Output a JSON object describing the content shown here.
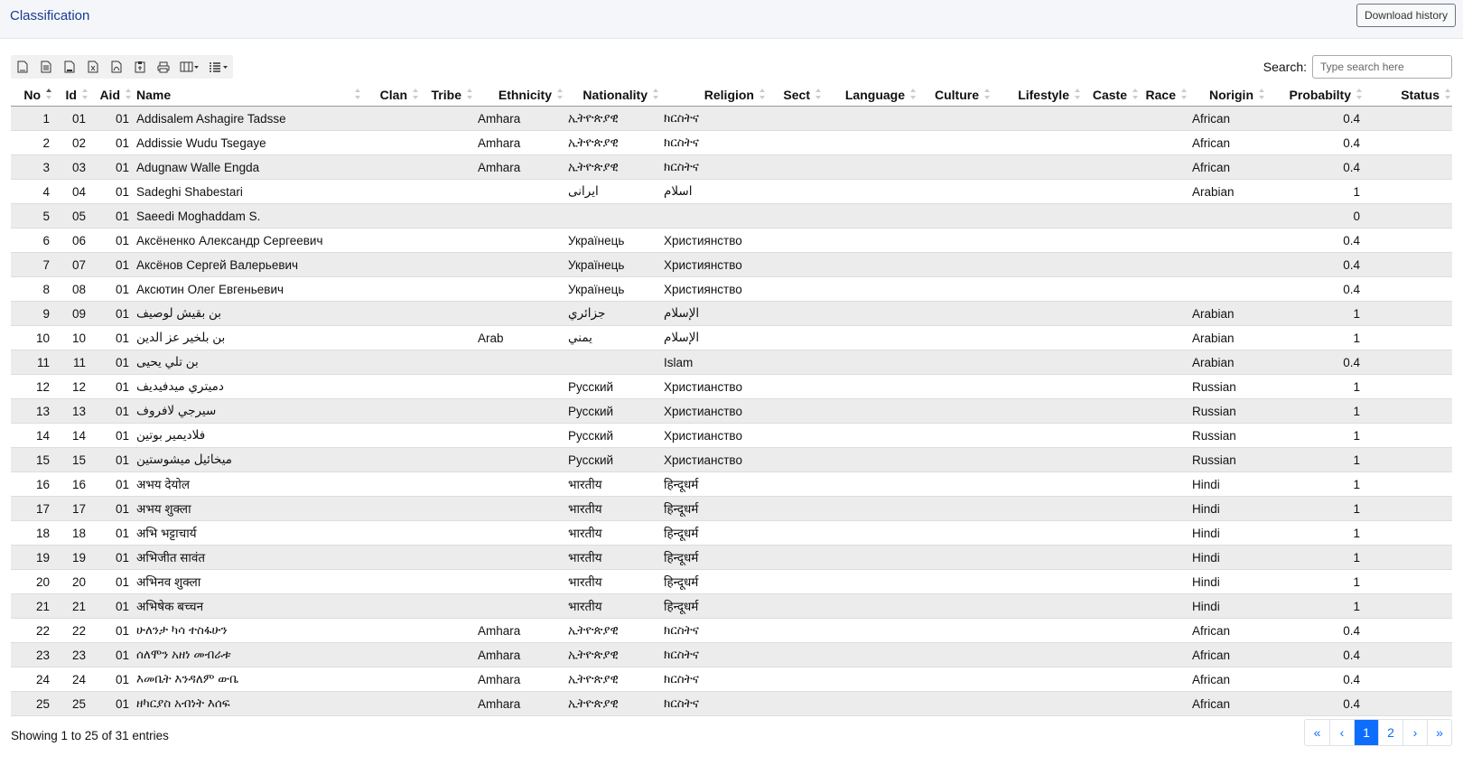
{
  "header": {
    "title": "Classification",
    "download_label": "Download history"
  },
  "toolbar": {
    "buttons": [
      "csv-export-icon",
      "copy-icon",
      "pdf-export-icon",
      "excel-export-icon",
      "file-export-icon",
      "clipboard-icon",
      "print-icon",
      "column-visibility-icon",
      "page-length-icon"
    ]
  },
  "search": {
    "label": "Search:",
    "placeholder": "Type search here"
  },
  "table": {
    "columns": [
      "No",
      "Id",
      "Aid",
      "Name",
      "Clan",
      "Tribe",
      "Ethnicity",
      "Nationality",
      "Religion",
      "Sect",
      "Language",
      "Culture",
      "Lifestyle",
      "Caste",
      "Race",
      "Norigin",
      "Probabilty",
      "Status"
    ],
    "rows": [
      [
        "1",
        "01",
        "01",
        "Addisalem Ashagire Tadsse",
        "",
        "",
        "Amhara",
        "ኢትዮጵያዊ",
        "ክርስትና",
        "",
        "",
        "",
        "",
        "",
        "",
        "African",
        "0.4",
        ""
      ],
      [
        "2",
        "02",
        "01",
        "Addissie Wudu Tsegaye",
        "",
        "",
        "Amhara",
        "ኢትዮጵያዊ",
        "ክርስትና",
        "",
        "",
        "",
        "",
        "",
        "",
        "African",
        "0.4",
        ""
      ],
      [
        "3",
        "03",
        "01",
        "Adugnaw Walle Engda",
        "",
        "",
        "Amhara",
        "ኢትዮጵያዊ",
        "ክርስትና",
        "",
        "",
        "",
        "",
        "",
        "",
        "African",
        "0.4",
        ""
      ],
      [
        "4",
        "04",
        "01",
        "Sadeghi Shabestari",
        "",
        "",
        "",
        "ایرانی",
        "اسلام",
        "",
        "",
        "",
        "",
        "",
        "",
        "Arabian",
        "1",
        ""
      ],
      [
        "5",
        "05",
        "01",
        "Saeedi Moghaddam S.",
        "",
        "",
        "",
        "",
        "",
        "",
        "",
        "",
        "",
        "",
        "",
        "",
        "0",
        ""
      ],
      [
        "6",
        "06",
        "01",
        "Аксёненко Александр Сергеевич",
        "",
        "",
        "",
        "Українець",
        "Християнство",
        "",
        "",
        "",
        "",
        "",
        "",
        "",
        "0.4",
        ""
      ],
      [
        "7",
        "07",
        "01",
        "Аксёнов Сергей Валерьевич",
        "",
        "",
        "",
        "Українець",
        "Християнство",
        "",
        "",
        "",
        "",
        "",
        "",
        "",
        "0.4",
        ""
      ],
      [
        "8",
        "08",
        "01",
        "Аксютин Олег Евгеньевич",
        "",
        "",
        "",
        "Українець",
        "Християнство",
        "",
        "",
        "",
        "",
        "",
        "",
        "",
        "0.4",
        ""
      ],
      [
        "9",
        "09",
        "01",
        "بن بقيش لوصيف",
        "",
        "",
        "",
        "جزائري",
        "الإسلام",
        "",
        "",
        "",
        "",
        "",
        "",
        "Arabian",
        "1",
        ""
      ],
      [
        "10",
        "10",
        "01",
        "بن بلخير عز الدين",
        "",
        "",
        "Arab",
        "يمني",
        "الإسلام",
        "",
        "",
        "",
        "",
        "",
        "",
        "Arabian",
        "1",
        ""
      ],
      [
        "11",
        "11",
        "01",
        "بن تلي يحيى",
        "",
        "",
        "",
        "",
        "Islam",
        "",
        "",
        "",
        "",
        "",
        "",
        "Arabian",
        "0.4",
        ""
      ],
      [
        "12",
        "12",
        "01",
        "دميتري ميدفيديف",
        "",
        "",
        "",
        "Русский",
        "Христианство",
        "",
        "",
        "",
        "",
        "",
        "",
        "Russian",
        "1",
        ""
      ],
      [
        "13",
        "13",
        "01",
        "سيرجي لافروف",
        "",
        "",
        "",
        "Русский",
        "Христианство",
        "",
        "",
        "",
        "",
        "",
        "",
        "Russian",
        "1",
        ""
      ],
      [
        "14",
        "14",
        "01",
        "فلاديمير بوتين",
        "",
        "",
        "",
        "Русский",
        "Христианство",
        "",
        "",
        "",
        "",
        "",
        "",
        "Russian",
        "1",
        ""
      ],
      [
        "15",
        "15",
        "01",
        "ميخائيل ميشوستين",
        "",
        "",
        "",
        "Русский",
        "Христианство",
        "",
        "",
        "",
        "",
        "",
        "",
        "Russian",
        "1",
        ""
      ],
      [
        "16",
        "16",
        "01",
        "अभय देयोल",
        "",
        "",
        "",
        "भारतीय",
        "हिन्दूधर्म",
        "",
        "",
        "",
        "",
        "",
        "",
        "Hindi",
        "1",
        ""
      ],
      [
        "17",
        "17",
        "01",
        "अभय शुक्ला",
        "",
        "",
        "",
        "भारतीय",
        "हिन्दूधर्म",
        "",
        "",
        "",
        "",
        "",
        "",
        "Hindi",
        "1",
        ""
      ],
      [
        "18",
        "18",
        "01",
        "अभि भट्टाचार्य",
        "",
        "",
        "",
        "भारतीय",
        "हिन्दूधर्म",
        "",
        "",
        "",
        "",
        "",
        "",
        "Hindi",
        "1",
        ""
      ],
      [
        "19",
        "19",
        "01",
        "अभिजीत सावंत",
        "",
        "",
        "",
        "भारतीय",
        "हिन्दूधर्म",
        "",
        "",
        "",
        "",
        "",
        "",
        "Hindi",
        "1",
        ""
      ],
      [
        "20",
        "20",
        "01",
        "अभिनव शुक्ला",
        "",
        "",
        "",
        "भारतीय",
        "हिन्दूधर्म",
        "",
        "",
        "",
        "",
        "",
        "",
        "Hindi",
        "1",
        ""
      ],
      [
        "21",
        "21",
        "01",
        "अभिषेक बच्चन",
        "",
        "",
        "",
        "भारतीय",
        "हिन्दूधर्म",
        "",
        "",
        "",
        "",
        "",
        "",
        "Hindi",
        "1",
        ""
      ],
      [
        "22",
        "22",
        "01",
        "ሁለንታ ካሳ ተስፋሁን",
        "",
        "",
        "Amhara",
        "ኢትዮጵያዊ",
        "ክርስትና",
        "",
        "",
        "",
        "",
        "",
        "",
        "African",
        "0.4",
        ""
      ],
      [
        "23",
        "23",
        "01",
        "ሰለሞን አዘነ መብራቱ",
        "",
        "",
        "Amhara",
        "ኢትዮጵያዊ",
        "ክርስትና",
        "",
        "",
        "",
        "",
        "",
        "",
        "African",
        "0.4",
        ""
      ],
      [
        "24",
        "24",
        "01",
        "እመቤት እንዳለም ውቤ",
        "",
        "",
        "Amhara",
        "ኢትዮጵያዊ",
        "ክርስትና",
        "",
        "",
        "",
        "",
        "",
        "",
        "African",
        "0.4",
        ""
      ],
      [
        "25",
        "25",
        "01",
        "ዘካርያስ አብነት እሰፍ",
        "",
        "",
        "Amhara",
        "ኢትዮጵያዊ",
        "ክርስትና",
        "",
        "",
        "",
        "",
        "",
        "",
        "African",
        "0.4",
        ""
      ]
    ]
  },
  "footer": {
    "info": "Showing 1 to 25 of 31 entries",
    "pagination": [
      "«",
      "‹",
      "1",
      "2",
      "›",
      "»"
    ],
    "active_page": "1"
  }
}
